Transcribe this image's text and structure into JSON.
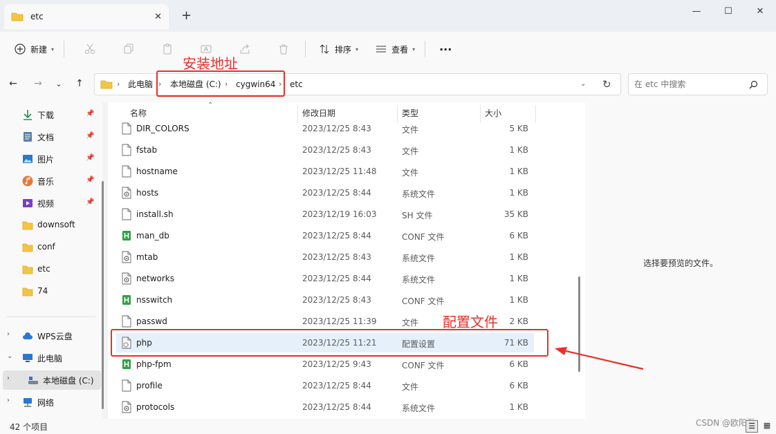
{
  "window": {
    "tab_title": "etc",
    "tab_close": "✕",
    "new_tab": "+",
    "minimize": "—",
    "maximize": "☐",
    "close": "✕"
  },
  "toolbar": {
    "new_label": "新建",
    "sort_label": "排序",
    "view_label": "查看",
    "more_label": "···"
  },
  "address": {
    "crumbs": [
      "此电脑",
      "本地磁盘 (C:)",
      "cygwin64",
      "etc"
    ],
    "search_placeholder": "在 etc 中搜索"
  },
  "sidebar": {
    "quick_access": [
      {
        "label": "下载",
        "icon": "download-icon",
        "pinned": true
      },
      {
        "label": "文档",
        "icon": "document-icon",
        "pinned": true
      },
      {
        "label": "图片",
        "icon": "pictures-icon",
        "pinned": true
      },
      {
        "label": "音乐",
        "icon": "music-icon",
        "pinned": true
      },
      {
        "label": "视频",
        "icon": "video-icon",
        "pinned": true
      },
      {
        "label": "downsoft",
        "icon": "folder-icon",
        "pinned": false
      },
      {
        "label": "conf",
        "icon": "folder-icon",
        "pinned": false
      },
      {
        "label": "etc",
        "icon": "folder-icon",
        "pinned": false
      },
      {
        "label": "74",
        "icon": "folder-icon",
        "pinned": false
      }
    ],
    "tree": [
      {
        "label": "WPS云盘",
        "icon": "cloud-icon",
        "chevron": "›"
      },
      {
        "label": "此电脑",
        "icon": "pc-icon",
        "chevron": "⌄"
      },
      {
        "label": "本地磁盘 (C:)",
        "icon": "drive-icon",
        "chevron": "›"
      },
      {
        "label": "网络",
        "icon": "network-icon",
        "chevron": "›"
      }
    ]
  },
  "columns": {
    "name": "名称",
    "date": "修改日期",
    "type": "类型",
    "size": "大小"
  },
  "files": [
    {
      "name": "DIR_COLORS",
      "date": "2023/12/25 8:43",
      "type": "文件",
      "size": "5 KB",
      "icon": "file-icon"
    },
    {
      "name": "fstab",
      "date": "2023/12/25 8:43",
      "type": "文件",
      "size": "1 KB",
      "icon": "file-icon"
    },
    {
      "name": "hostname",
      "date": "2023/12/25 11:48",
      "type": "文件",
      "size": "1 KB",
      "icon": "file-icon"
    },
    {
      "name": "hosts",
      "date": "2023/12/25 8:44",
      "type": "系统文件",
      "size": "1 KB",
      "icon": "system-file-icon"
    },
    {
      "name": "install.sh",
      "date": "2023/12/19 16:03",
      "type": "SH 文件",
      "size": "35 KB",
      "icon": "file-icon"
    },
    {
      "name": "man_db",
      "date": "2023/12/25 8:44",
      "type": "CONF 文件",
      "size": "6 KB",
      "icon": "conf-file-icon"
    },
    {
      "name": "mtab",
      "date": "2023/12/25 8:43",
      "type": "系统文件",
      "size": "1 KB",
      "icon": "system-file-icon"
    },
    {
      "name": "networks",
      "date": "2023/12/25 8:44",
      "type": "系统文件",
      "size": "1 KB",
      "icon": "system-file-icon"
    },
    {
      "name": "nsswitch",
      "date": "2023/12/25 8:43",
      "type": "CONF 文件",
      "size": "1 KB",
      "icon": "conf-file-icon"
    },
    {
      "name": "passwd",
      "date": "2023/12/25 11:39",
      "type": "文件",
      "size": "2 KB",
      "icon": "file-icon"
    },
    {
      "name": "php",
      "date": "2023/12/25 11:21",
      "type": "配置设置",
      "size": "71 KB",
      "icon": "settings-file-icon",
      "selected": true
    },
    {
      "name": "php-fpm",
      "date": "2023/12/25 9:43",
      "type": "CONF 文件",
      "size": "6 KB",
      "icon": "conf-file-icon"
    },
    {
      "name": "profile",
      "date": "2023/12/25 8:44",
      "type": "文件",
      "size": "6 KB",
      "icon": "file-icon"
    },
    {
      "name": "protocols",
      "date": "2023/12/25 8:44",
      "type": "系统文件",
      "size": "1 KB",
      "icon": "system-file-icon"
    }
  ],
  "preview": {
    "message": "选择要预览的文件。"
  },
  "status": {
    "item_count": "42 个项目"
  },
  "watermark": "CSDN @欧阳磊",
  "annotations": {
    "address_label": "安装地址",
    "config_label": "配置文件",
    "color": "#e8302a"
  },
  "colors": {
    "folder": "#f4c543",
    "conf_green": "#2ea043",
    "selection": "#e5f0fb",
    "accent": "#0067c0"
  }
}
